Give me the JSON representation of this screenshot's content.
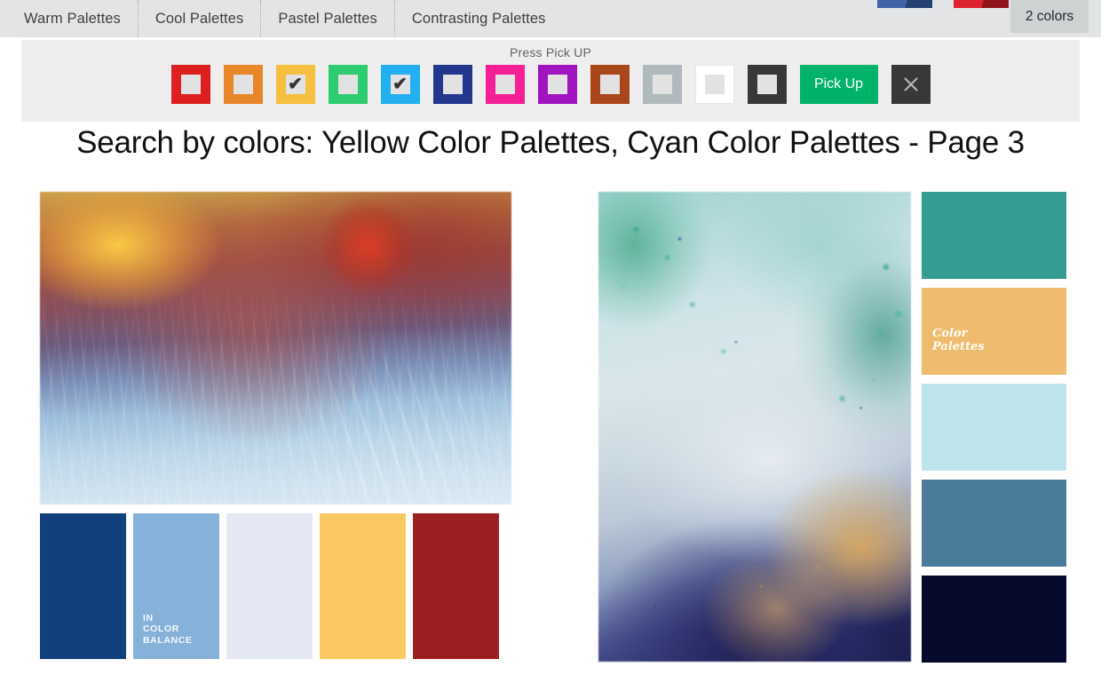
{
  "nav": {
    "items": [
      {
        "label": "Warm Palettes"
      },
      {
        "label": "Cool Palettes"
      },
      {
        "label": "Pastel Palettes"
      },
      {
        "label": "Contrasting Palettes"
      }
    ]
  },
  "header": {
    "colors_badge": "2 colors",
    "mini_bars": [
      {
        "name": "blue-bar",
        "color": "#3f62a8"
      },
      {
        "name": "red-bar",
        "color": "#dd2230"
      }
    ]
  },
  "picker": {
    "hint": "Press Pick UP",
    "pickup_label": "Pick Up",
    "close_label": "close-icon",
    "check_glyph": "✔",
    "swatches": [
      {
        "name": "red",
        "color": "#dd1f1f",
        "selected": false
      },
      {
        "name": "orange",
        "color": "#e8862a",
        "selected": false
      },
      {
        "name": "yellow",
        "color": "#f6bf3f",
        "selected": true
      },
      {
        "name": "green",
        "color": "#2ecc71",
        "selected": false
      },
      {
        "name": "cyan",
        "color": "#23b0f0",
        "selected": true
      },
      {
        "name": "blue",
        "color": "#23378f",
        "selected": false
      },
      {
        "name": "pink",
        "color": "#f51f96",
        "selected": false
      },
      {
        "name": "purple",
        "color": "#a015c0",
        "selected": false
      },
      {
        "name": "brown",
        "color": "#a9461a",
        "selected": false
      },
      {
        "name": "gray",
        "color": "#b0b9bb",
        "selected": false
      },
      {
        "name": "white",
        "color": "#ffffff",
        "selected": false
      },
      {
        "name": "black",
        "color": "#383838",
        "selected": false
      }
    ]
  },
  "page": {
    "title": "Search by colors: Yellow Color Palettes, Cyan Color Palettes - Page 3"
  },
  "cards": [
    {
      "id": "palette-card-1",
      "photo_name": "frosted-winter-grass-photo",
      "watermark": "IN\nCOLOR\nBALANCE",
      "watermark_swatch_index": 1,
      "swatches": [
        {
          "color": "#123f7d"
        },
        {
          "color": "#86b1d8"
        },
        {
          "color": "#e3e8f3"
        },
        {
          "color": "#fac961"
        },
        {
          "color": "#9c1f22"
        }
      ]
    },
    {
      "id": "palette-card-2",
      "photo_name": "turquoise-mineral-macro-photo",
      "watermark": "Color\nPalettes",
      "watermark_swatch_index": 1,
      "swatches": [
        {
          "color": "#349c91"
        },
        {
          "color": "#efbb6e"
        },
        {
          "color": "#bde4ec"
        },
        {
          "color": "#4b7b9b"
        },
        {
          "color": "#060a2c"
        }
      ]
    }
  ]
}
